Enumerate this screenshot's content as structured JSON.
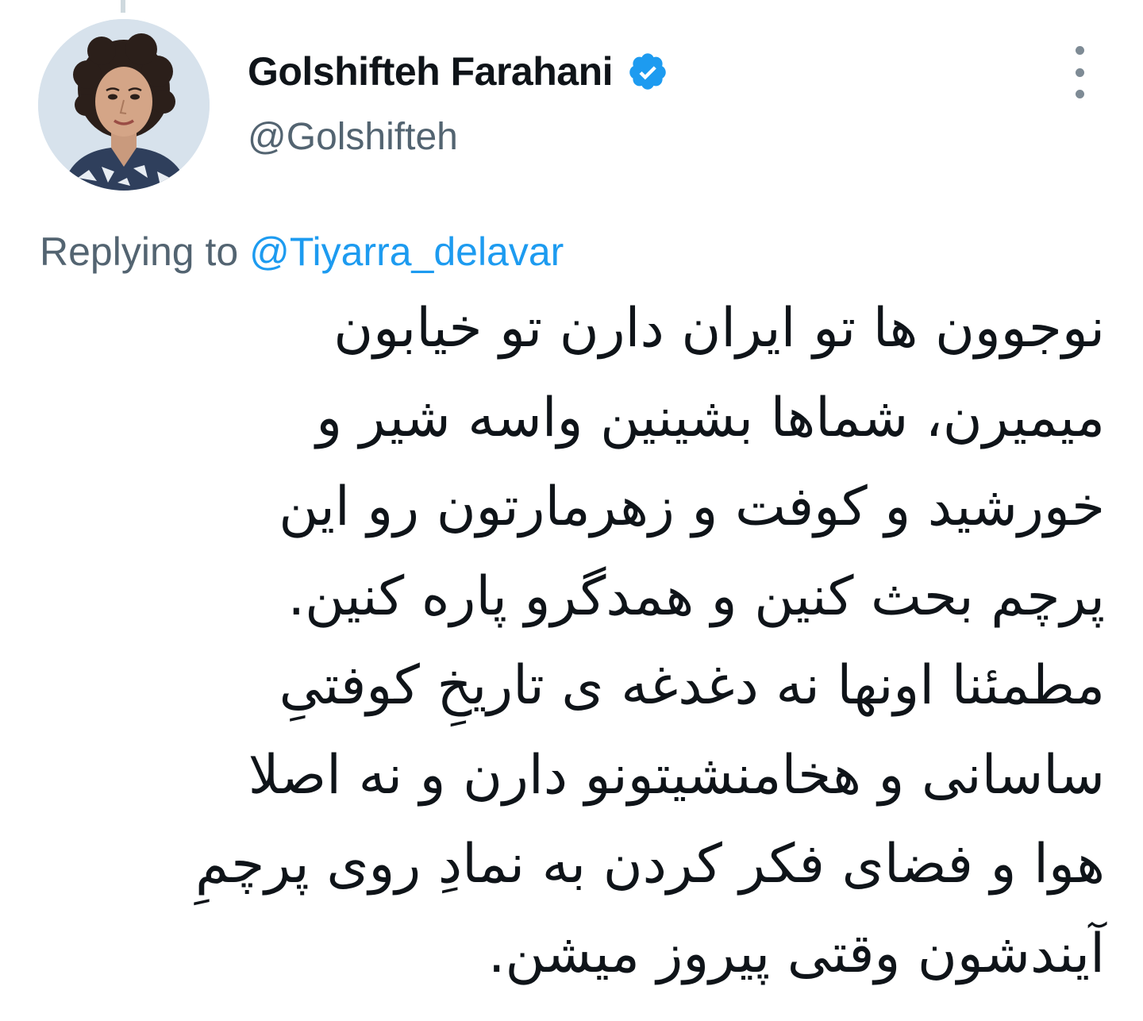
{
  "tweet": {
    "author": {
      "display_name": "Golshifteh Farahani",
      "handle": "@Golshifteh",
      "verified_icon": "verified-badge-icon",
      "avatar": "avatar-photo"
    },
    "more_icon": "more-vertical-icon",
    "replying_to": {
      "prefix": "Replying to",
      "handle": "@Tiyarra_delavar"
    },
    "text_lines": [
      "نوجوون ها تو ایران دارن تو خیابون",
      "میمیرن، شماها بشینین واسه شیر و",
      "خورشید و کوفت و زهرمارتون رو این",
      "پرچم بحث کنین و همدگرو پاره کنین.",
      "مطمئنا اونها نه دغدغه ی تاریخِ کوفتیِ",
      "ساسانی و هخامنشیتونو دارن و نه اصلا",
      "هوا و فضای فکر کردن به نمادِ روی پرچمِ",
      "آیندشون وقتی پیروز میشن."
    ]
  },
  "colors": {
    "text": "#0f1419",
    "secondary": "#536471",
    "link": "#1d9bf0",
    "verified": "#1d9bf0"
  }
}
